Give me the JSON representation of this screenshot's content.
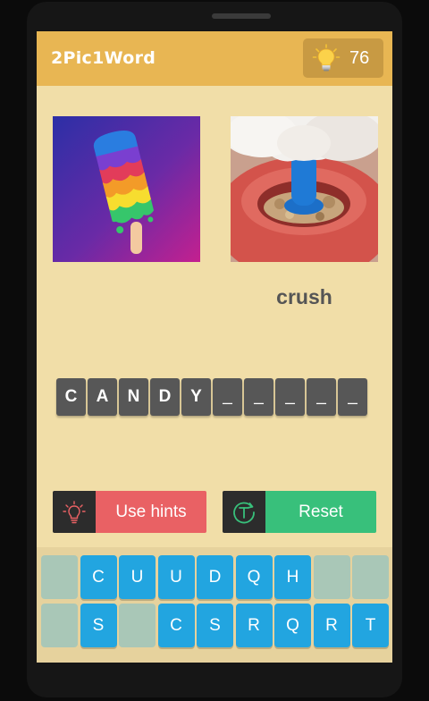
{
  "app": {
    "title": "2Pic1Word",
    "hint_count": "76"
  },
  "pictures": [
    {
      "label": "",
      "name": "popsicle"
    },
    {
      "label": "crush",
      "name": "crushing"
    }
  ],
  "answer": {
    "slots": [
      "C",
      "A",
      "N",
      "D",
      "Y",
      "_",
      "_",
      "_",
      "_",
      "_"
    ]
  },
  "buttons": {
    "hints_label": "Use hints",
    "reset_label": "Reset"
  },
  "keyboard": {
    "row1": [
      "",
      "C",
      "U",
      "U",
      "D",
      "Q",
      "H",
      "",
      ""
    ],
    "row2": [
      "",
      "S",
      "",
      "C",
      "S",
      "R",
      "Q",
      "R",
      "T"
    ]
  },
  "colors": {
    "topbar": "#e8b653",
    "background": "#f1dea8",
    "hint_button": "#e96164",
    "reset_button": "#38c07b",
    "key": "#22a5e0",
    "slot": "#575757"
  }
}
